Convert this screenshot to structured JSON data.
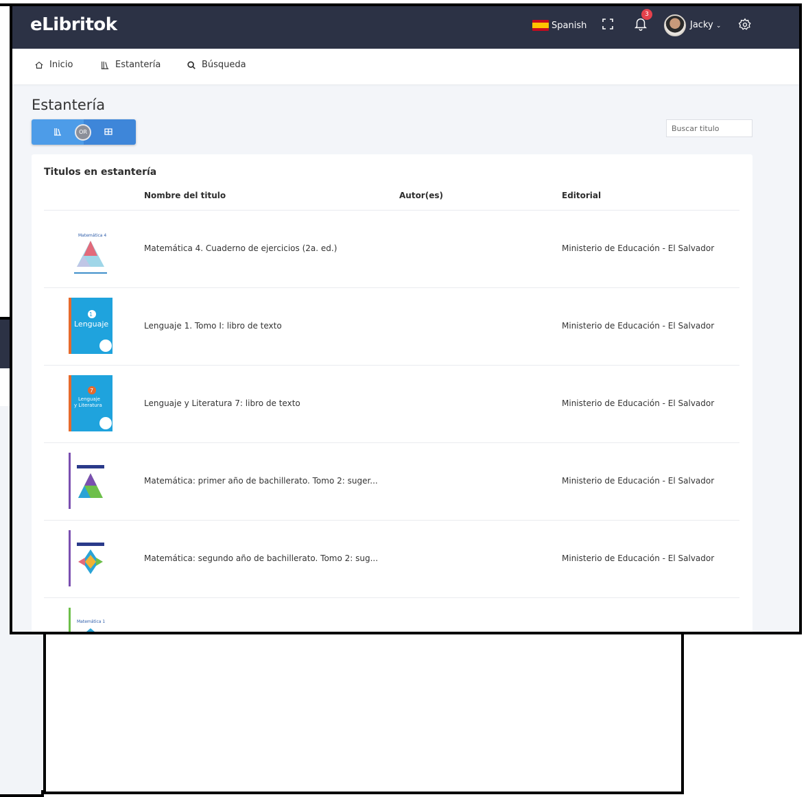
{
  "app": {
    "logo": "eLibritok",
    "language": "Spanish",
    "notifications_count": "3",
    "user_name": "Jacky"
  },
  "nav": {
    "items": [
      {
        "label": "Inicio",
        "icon": "home-icon"
      },
      {
        "label": "Estantería",
        "icon": "library-icon"
      },
      {
        "label": "Búsqueda",
        "icon": "search-icon"
      }
    ]
  },
  "page": {
    "title": "Estantería",
    "toggle_or": "OR",
    "search_placeholder": "Buscar titulo"
  },
  "table": {
    "card_title": "Titulos en estantería",
    "headers": [
      "Nombre del titulo",
      "Autor(es)",
      "Editorial"
    ],
    "rows": [
      {
        "title": "Matemática 4. Cuaderno de ejercicios (2a. ed.)",
        "publisher": "Ministerio de Educación - El Salvador",
        "cover": "math-triangle"
      },
      {
        "title": "Lenguaje 1. Tomo I: libro de texto",
        "publisher": "Ministerio de Educación - El Salvador",
        "cover": "lenguaje-1"
      },
      {
        "title": "Lenguaje y Literatura 7: libro de texto",
        "publisher": "Ministerio de Educación - El Salvador",
        "cover": "lenguaje-7"
      },
      {
        "title": "Matemática: primer año de bachillerato. Tomo 2: suger...",
        "publisher": "Ministerio de Educación - El Salvador",
        "cover": "math-bach-1"
      },
      {
        "title": "Matemática: segundo año de bachillerato. Tomo 2: sug...",
        "publisher": "Ministerio de Educación - El Salvador",
        "cover": "math-bach-2"
      },
      {
        "title": "",
        "publisher": "",
        "cover": "math-1"
      }
    ]
  },
  "colors": {
    "topbar": "#2c3245",
    "toggle_blue": "#4d9ce8",
    "badge_red": "#e5414c"
  }
}
